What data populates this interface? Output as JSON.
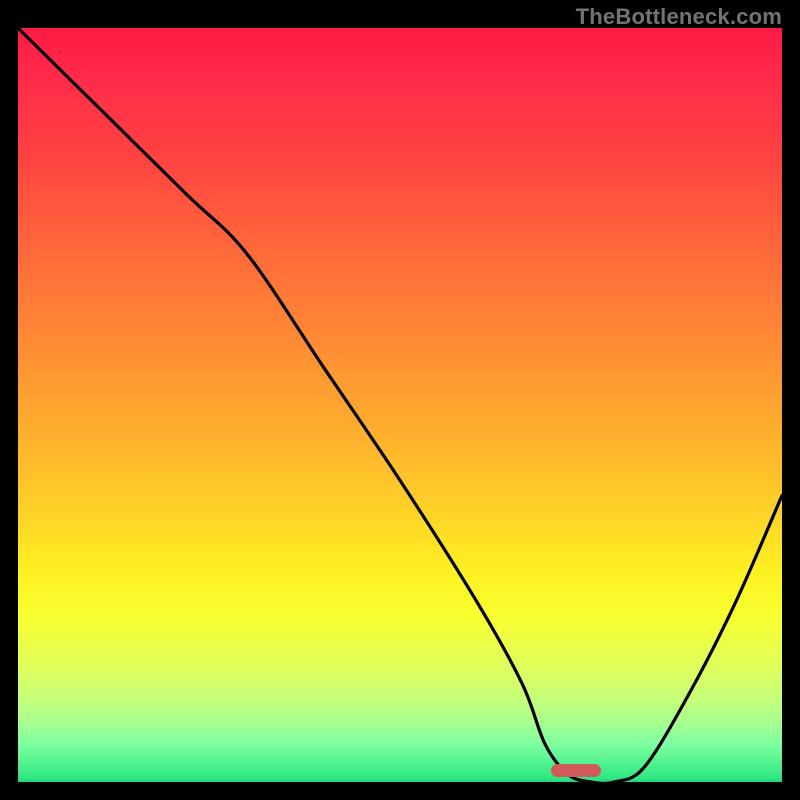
{
  "watermark": "TheBottleneck.com",
  "colors": {
    "page_bg": "#000000",
    "watermark": "#737373",
    "curve": "#000000",
    "marker": "#d05a5a"
  },
  "chart_data": {
    "type": "line",
    "title": "",
    "xlabel": "",
    "ylabel": "",
    "xlim": [
      0,
      100
    ],
    "ylim": [
      0,
      100
    ],
    "grid": false,
    "legend": false,
    "series": [
      {
        "name": "bottleneck-curve",
        "x": [
          0,
          10,
          22,
          30,
          40,
          50,
          60,
          66,
          69,
          72,
          75,
          78,
          82,
          88,
          94,
          100
        ],
        "y": [
          100,
          90,
          78,
          70,
          55,
          40,
          24,
          13,
          5,
          1,
          0,
          0,
          2,
          12,
          24,
          38
        ]
      }
    ],
    "marker": {
      "x_center_pct": 73,
      "y_bottom_pct": 0.7,
      "width_pct": 6.5,
      "height_pct": 1.7
    },
    "gradient_stops": [
      {
        "pos": 0,
        "color": "#ff1a46"
      },
      {
        "pos": 0.72,
        "color": "#fff022"
      },
      {
        "pos": 1.0,
        "color": "#20d878"
      }
    ]
  }
}
